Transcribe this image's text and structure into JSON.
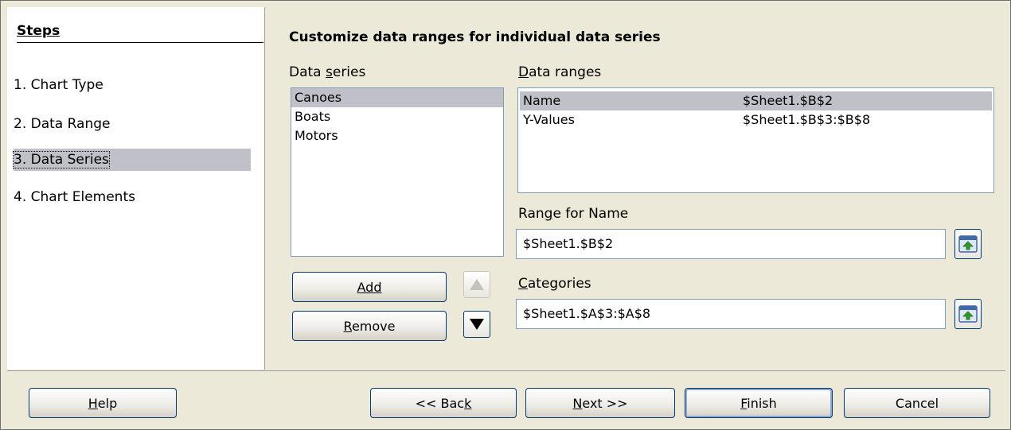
{
  "steps": {
    "title": "Steps",
    "items": [
      {
        "label": "1. Chart Type"
      },
      {
        "label": "2. Data Range"
      },
      {
        "label": "3. Data Series"
      },
      {
        "label": "4. Chart Elements"
      }
    ],
    "selected_index": 2
  },
  "main": {
    "heading": "Customize data ranges for individual data series",
    "data_series_label": "Data series",
    "data_series": [
      "Canoes",
      "Boats",
      "Motors"
    ],
    "data_ranges_label": "Data ranges",
    "data_ranges": [
      {
        "role": "Name",
        "range": "$Sheet1.$B$2"
      },
      {
        "role": "Y-Values",
        "range": "$Sheet1.$B$3:$B$8"
      }
    ],
    "range_for_name_label": "Range for Name",
    "range_for_name_value": "$Sheet1.$B$2",
    "categories_label": "Categories",
    "categories_value": "$Sheet1.$A$3:$A$8",
    "add_label": "Add",
    "remove_label": "Remove"
  },
  "footer": {
    "help": "Help",
    "back": "<< Back",
    "next": "Next >>",
    "finish": "Finish",
    "cancel": "Cancel"
  },
  "icons": {
    "move_up": "triangle-up-icon",
    "move_down": "triangle-down-icon",
    "shrink": "shrink-range-icon"
  }
}
